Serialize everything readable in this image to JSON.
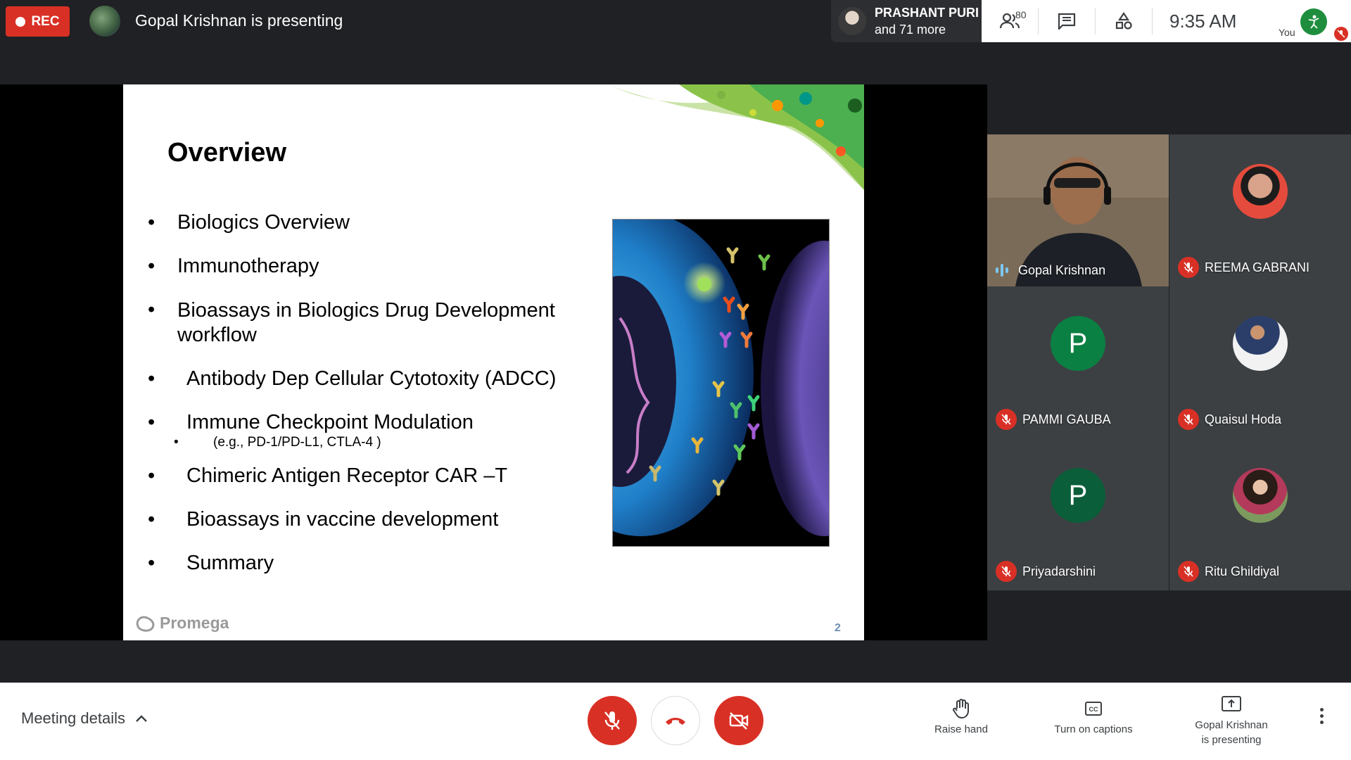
{
  "recording": {
    "label": "REC"
  },
  "header": {
    "presenting_text": "Gopal Krishnan is presenting"
  },
  "participants_chip": {
    "line1": "PRASHANT PURI",
    "line2": "and 71 more"
  },
  "top_panel": {
    "participant_count": "80",
    "clock": "9:35  AM",
    "you_label": "You"
  },
  "slide": {
    "title": "Overview",
    "bullets": [
      {
        "text": "Biologics Overview"
      },
      {
        "text": "Immunotherapy"
      },
      {
        "text": "Bioassays in Biologics Drug Development workflow"
      },
      {
        "text": "Antibody Dep Cellular Cytotoxity (ADCC)"
      },
      {
        "text": "Immune Checkpoint Modulation"
      },
      {
        "text": "Chimeric Antigen Receptor CAR –T"
      },
      {
        "text": "Bioassays in vaccine development"
      },
      {
        "text": "Summary"
      }
    ],
    "sub_bullet": "(e.g., PD-1/PD-L1, CTLA-4 )",
    "bullet_char": "•",
    "logo_text": "Promega",
    "page_number": "2"
  },
  "participants": [
    {
      "name": "Gopal Krishnan",
      "type": "video",
      "muted": false,
      "speaking": true
    },
    {
      "name": "REEMA GABRANI",
      "type": "photo",
      "muted": true
    },
    {
      "name": "PAMMI GAUBA",
      "type": "initial",
      "initial": "P",
      "avatar_color": "#0b8043",
      "muted": true
    },
    {
      "name": "Quaisul Hoda",
      "type": "photo",
      "muted": true
    },
    {
      "name": "Priyadarshini",
      "type": "initial",
      "initial": "P",
      "avatar_color": "#0b5e3a",
      "muted": true
    },
    {
      "name": "Ritu Ghildiyal",
      "type": "photo",
      "muted": true
    }
  ],
  "bottom_bar": {
    "meeting_details": "Meeting details",
    "raise_hand": "Raise hand",
    "captions": "Turn on captions",
    "present_line1": "Gopal Krishnan",
    "present_line2": "is presenting"
  },
  "colors": {
    "danger": "#d93025",
    "meet_dark": "#202124",
    "tile": "#3c4043",
    "speaking": "#7cc7f0"
  }
}
